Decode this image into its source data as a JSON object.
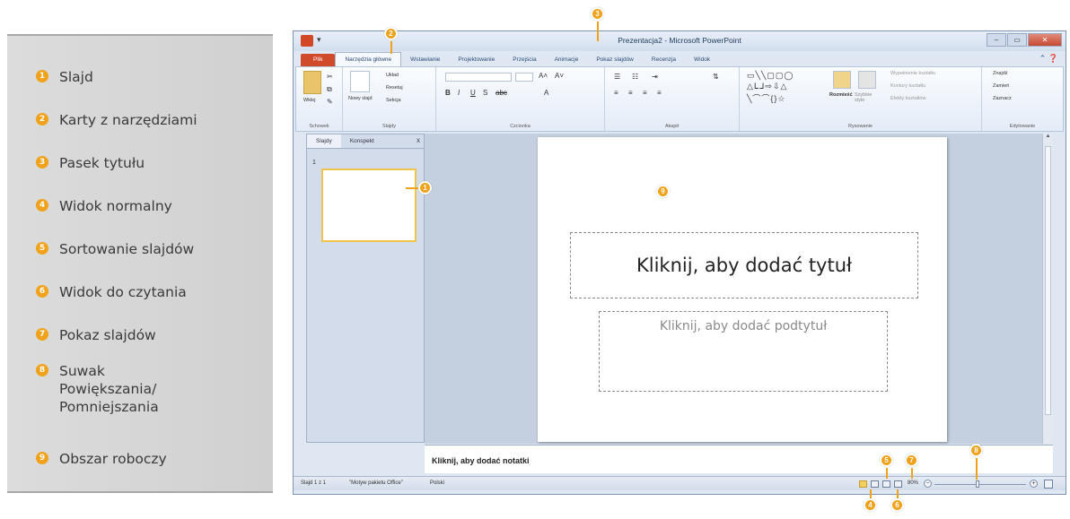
{
  "legend": {
    "items": [
      {
        "num": "1",
        "label": "Slajd"
      },
      {
        "num": "2",
        "label": "Karty z narzędziami"
      },
      {
        "num": "3",
        "label": "Pasek tytułu"
      },
      {
        "num": "4",
        "label": "Widok normalny"
      },
      {
        "num": "5",
        "label": "Sortowanie slajdów"
      },
      {
        "num": "6",
        "label": "Widok do czytania"
      },
      {
        "num": "7",
        "label": "Pokaz slajdów"
      },
      {
        "num": "8",
        "label": "Suwak Powiększania/ Pomniejszania"
      },
      {
        "num": "9",
        "label": "Obszar roboczy"
      }
    ]
  },
  "window": {
    "title": "Prezentacja2 - Microsoft PowerPoint",
    "tabs": [
      "Plik",
      "Narzędzia główne",
      "Wstawianie",
      "Projektowanie",
      "Przejścia",
      "Animacje",
      "Pokaz slajdów",
      "Recenzja",
      "Widok"
    ],
    "active_tab": "Narzędzia główne"
  },
  "ribbon": {
    "groups": [
      "Schowek",
      "Slajdy",
      "Czcionka",
      "Akapit",
      "Rysowanie",
      "Edytowanie"
    ],
    "paste": "Wklej",
    "new_slide": "Nowy slajd",
    "layout": "Układ",
    "reset": "Resetuj",
    "section": "Sekcja",
    "arrange": "Rozmieść",
    "quick_styles": "Szybkie style",
    "shape_fill": "Wypełnienie kształtu",
    "shape_outline": "Kontury kształtu",
    "shape_effects": "Efekty kształtów",
    "find": "Znajdź",
    "replace": "Zamień",
    "select": "Zaznacz"
  },
  "left_pane": {
    "tab_slides": "Slajdy",
    "tab_outline": "Konspekt",
    "close": "x",
    "slide_number": "1"
  },
  "slide": {
    "title_placeholder": "Kliknij, aby dodać tytuł",
    "subtitle_placeholder": "Kliknij, aby dodać podtytuł"
  },
  "notes": {
    "placeholder": "Kliknij, aby dodać notatki"
  },
  "statusbar": {
    "slide_info": "Slajd 1 z 1",
    "theme": "\"Motyw pakietu Office\"",
    "language": "Polski",
    "zoom": "80%"
  },
  "callouts": [
    "1",
    "2",
    "3",
    "4",
    "5",
    "6",
    "7",
    "8",
    "9"
  ],
  "colors": {
    "accent": "#f0a21a",
    "file_tab": "#d04a2c"
  }
}
